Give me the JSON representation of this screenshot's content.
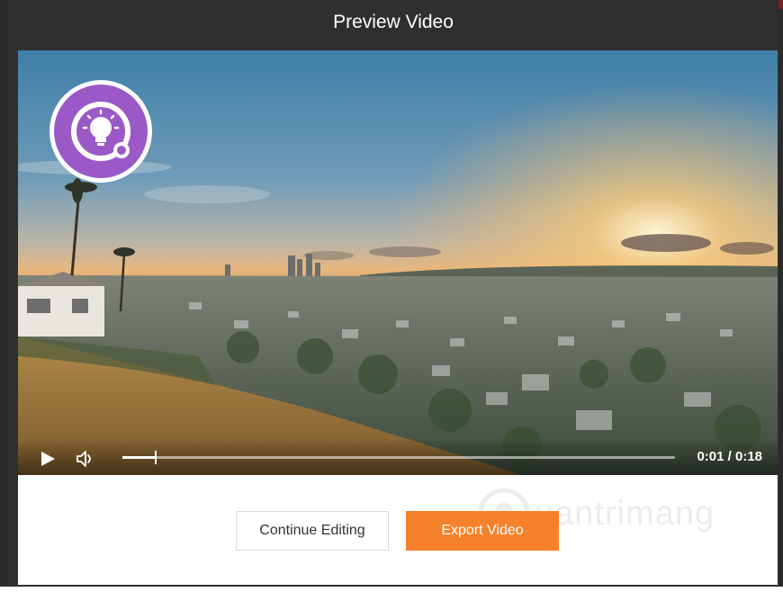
{
  "dialog": {
    "title": "Preview Video"
  },
  "player": {
    "current_time": "0:01",
    "separator": "/",
    "duration": "0:18",
    "time_display": "0:01 / 0:18",
    "progress_fraction": 0.06,
    "icons": {
      "play": "play-icon",
      "volume": "volume-icon",
      "badge": "lightbulb-icon"
    },
    "badge_color": "#9b59c8"
  },
  "actions": {
    "continue_label": "Continue Editing",
    "export_label": "Export Video",
    "export_color": "#f5822a"
  },
  "watermark": {
    "text": "uantrimang"
  }
}
